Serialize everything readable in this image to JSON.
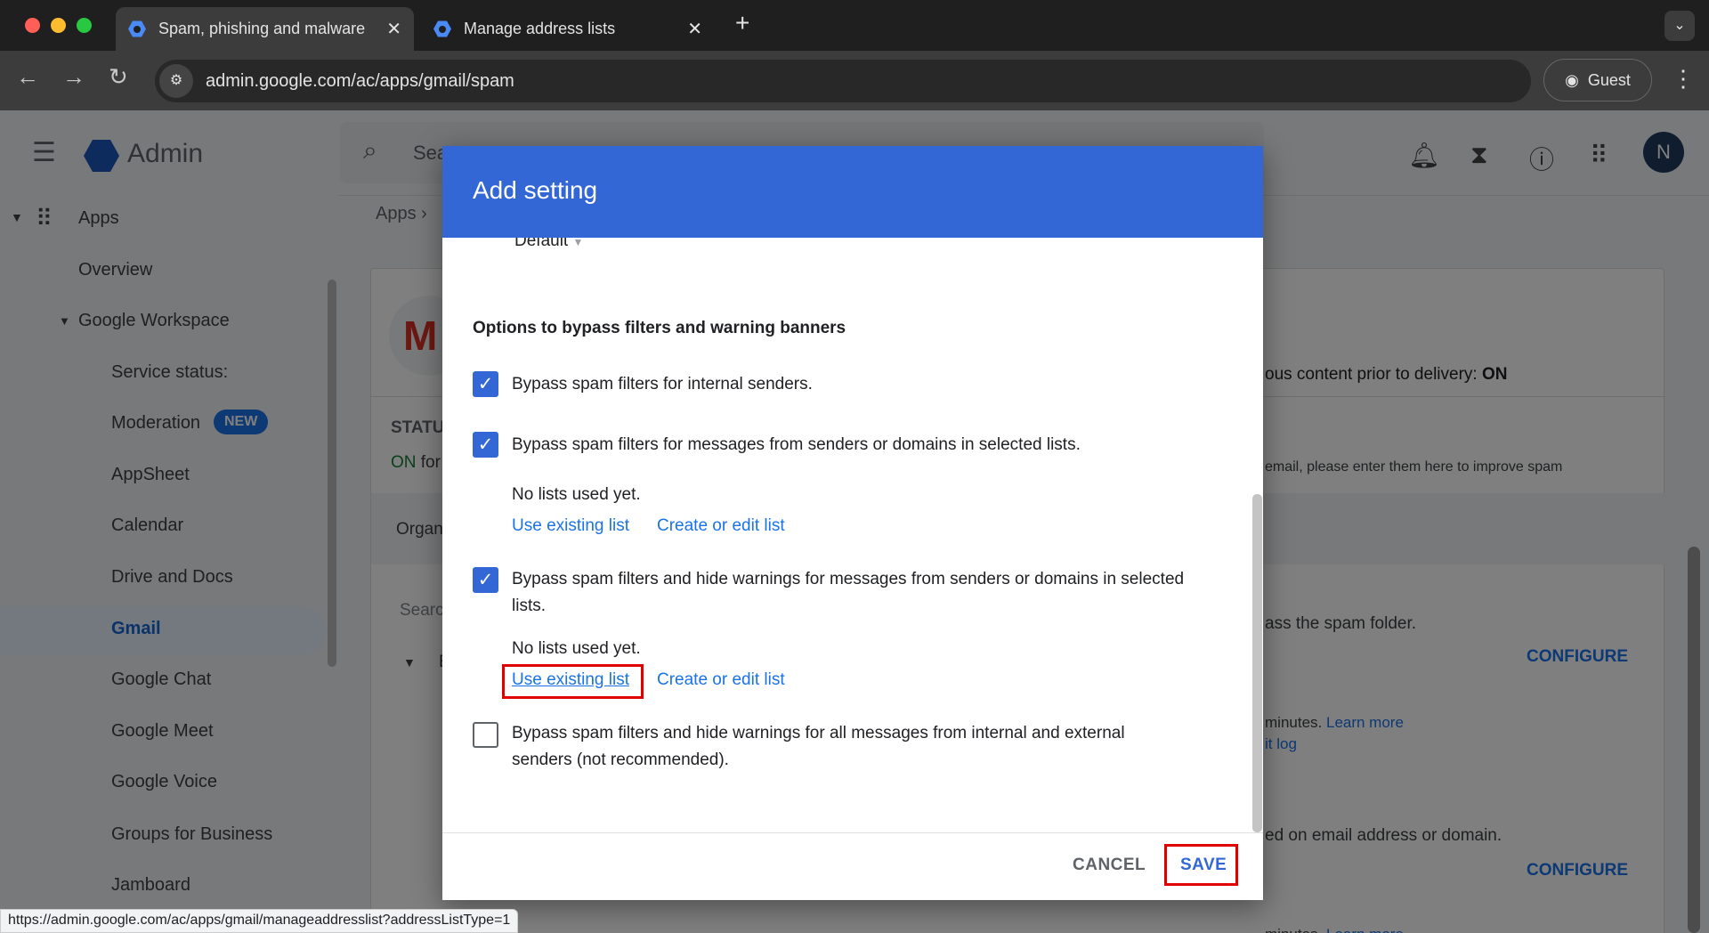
{
  "browser": {
    "tabs": [
      {
        "title": "Spam, phishing and malware",
        "active": true
      },
      {
        "title": "Manage address lists",
        "active": false
      }
    ],
    "url": "admin.google.com/ac/apps/gmail/spam",
    "profile": "Guest",
    "status_url": "https://admin.google.com/ac/apps/gmail/manageaddresslist?addressListType=1"
  },
  "header": {
    "app_name": "Admin",
    "search_placeholder": "Sea",
    "avatar_letter": "N",
    "breadcrumb": "Apps"
  },
  "sidebar": {
    "apps": "Apps",
    "overview": "Overview",
    "workspace": "Google Workspace",
    "items": [
      {
        "label": "Service status:"
      },
      {
        "label": "Moderation",
        "badge": "NEW"
      },
      {
        "label": "AppSheet"
      },
      {
        "label": "Calendar"
      },
      {
        "label": "Drive and Docs"
      },
      {
        "label": "Gmail",
        "active": true
      },
      {
        "label": "Google Chat"
      },
      {
        "label": "Google Meet"
      },
      {
        "label": "Google Voice"
      },
      {
        "label": "Groups for Business"
      },
      {
        "label": "Jamboard"
      }
    ]
  },
  "background": {
    "status_label": "STATU",
    "status_value": "ON",
    "status_suffix": "for",
    "org": "Organ",
    "search": "Searc",
    "row": "E",
    "line1": "ous content prior to delivery: ",
    "line1_value": "ON",
    "line2": "email, please enter them here to improve spam",
    "line3": "ass the spam folder.",
    "configure": "CONFIGURE",
    "minutes": "minutes. ",
    "learn_more": "Learn more",
    "audit": "it log",
    "line4": "ed on email address or domain."
  },
  "dialog": {
    "title": "Add setting",
    "default_select": "Default",
    "section_heading": "Options to bypass filters and warning banners",
    "options": [
      {
        "label": "Bypass spam filters for internal senders.",
        "checked": true
      },
      {
        "label": "Bypass spam filters for messages from senders or domains in selected lists.",
        "checked": true,
        "lists_status": "No lists used yet."
      },
      {
        "label": "Bypass spam filters and hide warnings for messages from senders or domains in selected lists.",
        "checked": true,
        "lists_status": "No lists used yet."
      },
      {
        "label": "Bypass spam filters and hide warnings for all messages from internal and external senders (not recommended).",
        "checked": false
      }
    ],
    "use_existing": "Use existing list",
    "create_edit": "Create or edit list",
    "cancel": "CANCEL",
    "save": "SAVE"
  },
  "colors": {
    "accent": "#3367d6",
    "link": "#1a73e8",
    "highlight": "#e00000"
  }
}
